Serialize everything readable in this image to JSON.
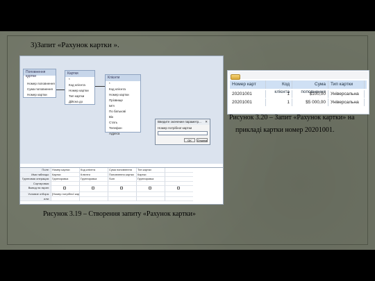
{
  "heading": "3)Запит «Рахунок картки ».",
  "query_designer": {
    "tables": [
      {
        "title": "Поповнення картки",
        "fields": [
          "*",
          "Номер поповнення",
          "Сума поповнення",
          "Номер картки"
        ]
      },
      {
        "title": "Картки",
        "fields": [
          "*",
          "Код клієнта",
          "Номер картки",
          "Тип картки",
          "Дійсна до"
        ]
      },
      {
        "title": "Клієнти",
        "fields": [
          "*",
          "Код клієнта",
          "Номер картки",
          "Прізвище",
          "Ім'я",
          "По батькові",
          "Вік",
          "Стать",
          "Телефон",
          "Адреса"
        ]
      }
    ],
    "dialog": {
      "title": "Введите значение параметр...",
      "label": "Номер потрібної картки",
      "ok": "OK",
      "cancel": "Отмена"
    },
    "grid": {
      "row_labels": [
        "Поле:",
        "Имя таблицы:",
        "Групповая операция:",
        "Сортировка:",
        "Вывод на экран:",
        "Условие отбора:",
        "или:"
      ],
      "columns": [
        {
          "field": "Номер картки",
          "table": "Картки",
          "group": "Группировка",
          "criteria": "[Номер потрібної картки]"
        },
        {
          "field": "Код клієнта",
          "table": "Клієнти",
          "group": "Группировка",
          "criteria": ""
        },
        {
          "field": "Сума поповнення",
          "table": "Поповнення картки",
          "group": "Sum",
          "criteria": ""
        },
        {
          "field": "Тип картки",
          "table": "Картки",
          "group": "Группировка",
          "criteria": ""
        }
      ]
    }
  },
  "result": {
    "headers": [
      "Номер карт",
      "Код клієнта",
      "Сума поповнення",
      "Тип картки"
    ],
    "rows": [
      [
        "20201001",
        "1",
        "$100,00",
        "Універсальна"
      ],
      [
        "20201001",
        "1",
        "$5 000,00",
        "Універсальна"
      ]
    ]
  },
  "captions": {
    "fig_319": "Рисунок 3.19  – Створення запиту «Рахунок картки»",
    "fig_320_line1": "Рисунок 3.20 – Запит «Рахунок картки» на",
    "fig_320_line2": "прикладі картки номер 20201001."
  }
}
